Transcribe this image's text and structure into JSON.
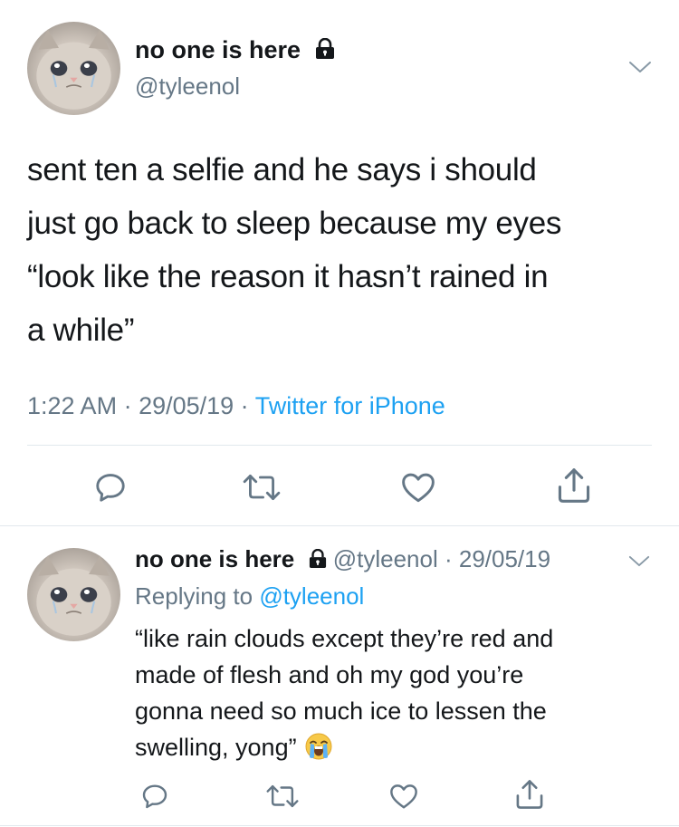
{
  "main_tweet": {
    "display_name": "no one is here",
    "handle": "@tyleenol",
    "text": "sent ten a selfie and he says i should\njust go back to sleep because my eyes\n“look like the reason it hasn’t rained in\na while”",
    "time": "1:22 AM",
    "sep1": " · ",
    "date": "29/05/19",
    "sep2": " · ",
    "source": "Twitter for iPhone",
    "icons": {
      "lock": "lock-icon",
      "menu": "chevron-down-icon",
      "reply": "reply-icon",
      "retweet": "retweet-icon",
      "like": "like-icon",
      "share": "share-icon"
    }
  },
  "reply_tweet": {
    "display_name": "no one is here",
    "handle": "@tyleenol",
    "date_separator": " · ",
    "date": "29/05/19",
    "replying_prefix": "Replying to ",
    "replying_to": "@tyleenol",
    "text": "“like rain clouds except they’re red and\nmade of flesh and oh my god you’re\ngonna need so much ice to lessen the\nswelling, yong”",
    "emoji": "loudly-crying-face"
  },
  "colors": {
    "text_primary": "#14171a",
    "text_secondary": "#657786",
    "link": "#1da1f2",
    "divider": "#e1e8ed"
  }
}
